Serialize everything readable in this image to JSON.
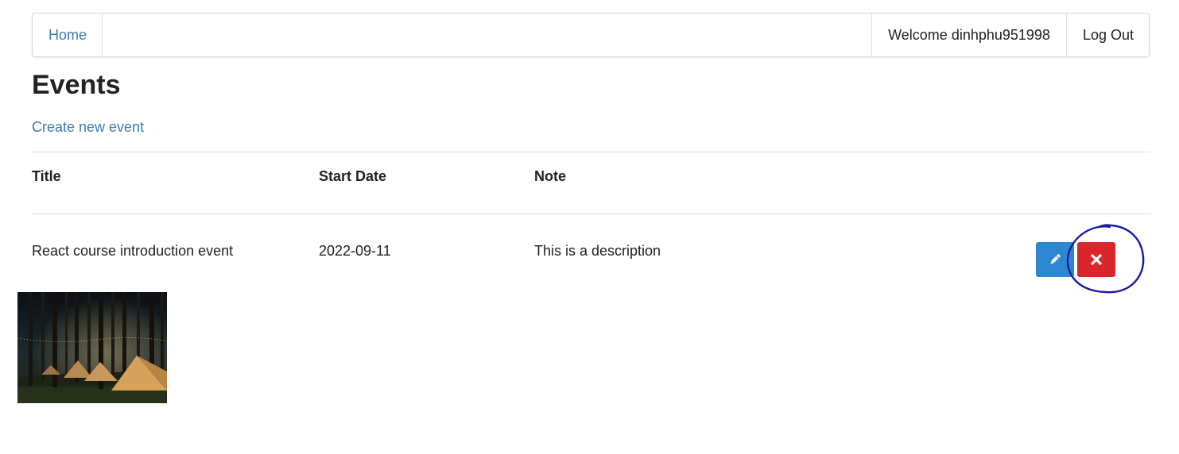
{
  "navbar": {
    "home_label": "Home",
    "welcome_text": "Welcome dinhphu951998",
    "logout_label": "Log Out"
  },
  "page": {
    "title": "Events",
    "create_link": "Create new event"
  },
  "table": {
    "headers": [
      "Title",
      "Start Date",
      "Note"
    ],
    "rows": [
      {
        "title": "React course introduction event",
        "start_date": "2022-09-11",
        "note": "This is a description"
      }
    ]
  },
  "icons": {
    "edit": "pencil-icon",
    "delete": "close-icon"
  },
  "colors": {
    "link": "#3f7ab5",
    "edit_button": "#2e86d1",
    "delete_button": "#d9262d",
    "annotation": "#1a1aa8"
  }
}
